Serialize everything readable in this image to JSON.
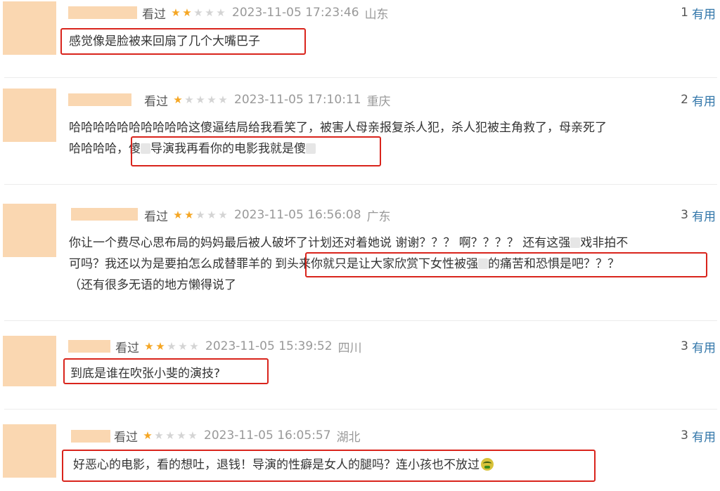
{
  "labels": {
    "watched": "看过",
    "useful": "有用"
  },
  "colors": {
    "star_on": "#f5a623",
    "star_off": "#d4d4d4",
    "useful_link": "#3377aa",
    "highlight_box": "#d9241c",
    "redacted_block": "#fad7b1"
  },
  "reviews": [
    {
      "rating": 2,
      "time": "2023-11-05 17:23:46",
      "location": "山东",
      "useful_count": "1",
      "lines": [
        "感觉像是脸被来回扇了几个大嘴巴子"
      ]
    },
    {
      "rating": 1,
      "time": "2023-11-05 17:10:11",
      "location": "重庆",
      "useful_count": "2",
      "lines": [
        "哈哈哈哈哈哈哈哈哈哈这傻逼结局给我看笑了，被害人母亲报复杀人犯，杀人犯被主角救了，母亲死了",
        "哈哈哈哈，",
        "傻",
        "导演我再看你的电影我就是傻"
      ]
    },
    {
      "rating": 2,
      "time": "2023-11-05 16:56:08",
      "location": "广东",
      "useful_count": "3",
      "lines": [
        "你让一个费尽心思布局的妈妈最后被人破坏了计划还对着她说 谢谢？？？ 啊？？？？ 还有这强",
        "戏非拍不",
        "可吗？我还以为是要拍怎么成替罪羊的",
        "到头来你就只是让大家欣赏下女性被强",
        "的痛苦和恐惧是吧？？？",
        "（还有很多无语的地方懒得说了"
      ]
    },
    {
      "rating": 2,
      "time": "2023-11-05 15:39:52",
      "location": "四川",
      "useful_count": "3",
      "lines": [
        "到底是谁在吹张小斐的演技?"
      ]
    },
    {
      "rating": 1,
      "time": "2023-11-05 16:05:57",
      "location": "湖北",
      "useful_count": "3",
      "lines": [
        "好恶心的电影，看的想吐，退钱！导演的性癖是女人的腿吗？连小孩也不放过"
      ],
      "emoji": "nauseated-face-icon"
    }
  ]
}
